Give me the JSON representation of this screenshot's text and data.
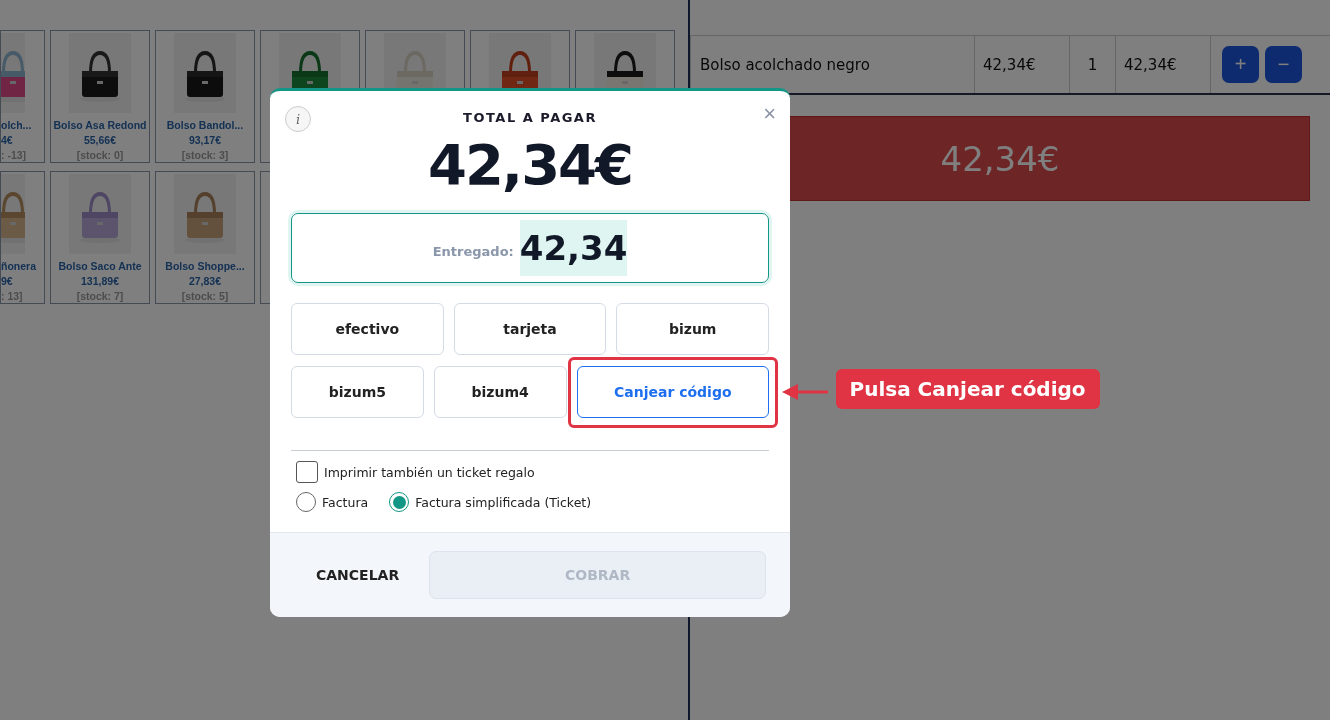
{
  "products": [
    {
      "kind": "picture",
      "name": "olch...",
      "price": "4€",
      "stock": ": -13]"
    },
    {
      "kind": "picture",
      "name": "Bolso Asa Redond",
      "price": "55,66€",
      "stock": "[stock: 0]"
    },
    {
      "kind": "picture",
      "name": "Bolso Bandol...",
      "price": "93,17€",
      "stock": "[stock: 3]"
    },
    {
      "kind": "picture"
    },
    {
      "kind": "picture"
    },
    {
      "kind": "picture"
    },
    {
      "kind": "picture"
    },
    {
      "kind": "picture",
      "name": "ñonera",
      "price": "9€",
      "stock": ": 13]"
    },
    {
      "kind": "picture",
      "name": "Bolso Saco Ante",
      "price": "131,89€",
      "stock": "[stock: 7]"
    },
    {
      "kind": "picture",
      "name": "Bolso Shoppe...",
      "price": "27,83€",
      "stock": "[stock: 5]"
    },
    {
      "kind": "blank"
    }
  ],
  "cart": {
    "rows": [
      {
        "name": "Bolso acolchado negro",
        "price": "42,34€",
        "qty": "1",
        "total": "42,34€",
        "plus": "+",
        "minus": "−"
      }
    ],
    "total": "42,34€"
  },
  "modal": {
    "title": "TOTAL A PAGAR",
    "info": "i",
    "close": "×",
    "amount": "42,34€",
    "received": {
      "label": "Entregado:",
      "value": "42,34"
    },
    "methods": [
      {
        "label": "efectivo",
        "kind": "method"
      },
      {
        "label": "tarjeta",
        "kind": "method"
      },
      {
        "label": "bizum",
        "kind": "method"
      },
      {
        "label": "bizum5",
        "kind": "method"
      },
      {
        "label": "bizum4",
        "kind": "method"
      },
      {
        "label": "Canjear código",
        "kind": "redeem"
      }
    ],
    "gift_ticket": {
      "label": "Imprimir también un ticket regalo",
      "checked": false
    },
    "invoice_types": [
      {
        "label": "Factura",
        "selected": false
      },
      {
        "label": "Factura simplificada (Ticket)",
        "selected": true
      }
    ],
    "cancel": "CANCELAR",
    "charge": {
      "label": "COBRAR",
      "disabled": true
    }
  },
  "annotation": {
    "text": "Pulsa Canjear código"
  }
}
